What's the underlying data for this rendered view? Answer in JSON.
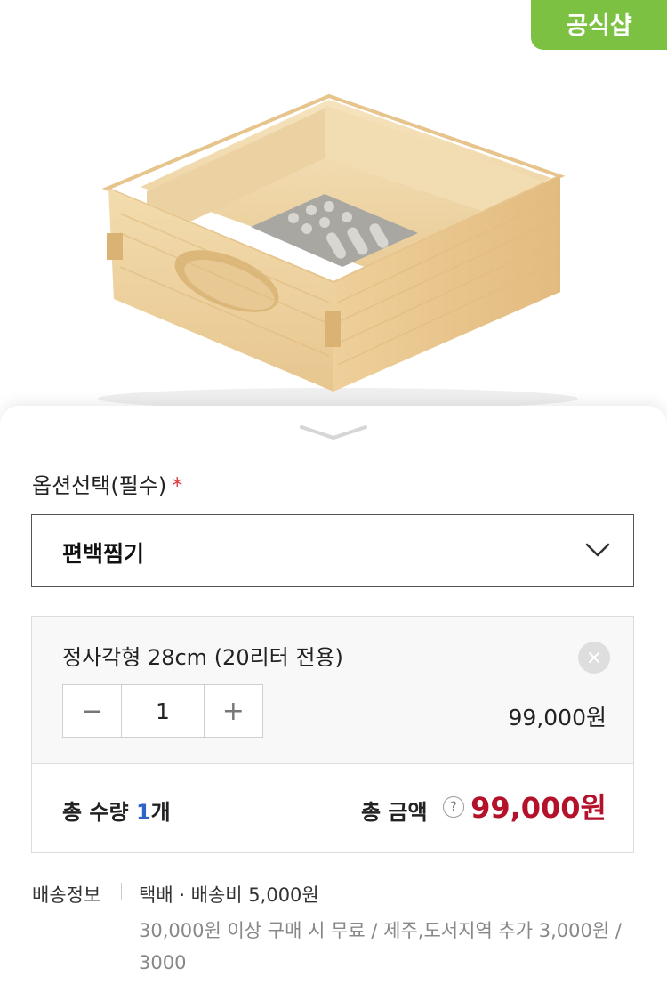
{
  "badge": {
    "label": "공식샵"
  },
  "options": {
    "label": "옵션선택(필수)",
    "required_mark": "*",
    "selected_value": "편백찜기"
  },
  "selected_item": {
    "name": "정사각형 28cm (20리터 전용)",
    "quantity": "1",
    "price": "99,000원",
    "decrease": "−",
    "increase": "+"
  },
  "totals": {
    "qty_prefix": "총 수량 ",
    "qty_value": "1",
    "qty_unit": "개",
    "amount_label": "총 금액",
    "help": "?",
    "amount_value": "99,000원"
  },
  "shipping": {
    "label": "배송정보",
    "line1": "택배 · 배송비 5,000원",
    "line2": "30,000원 이상 구매 시 무료 / 제주,도서지역 추가 3,000원 / 3000"
  },
  "colors": {
    "badge": "#7cc142",
    "total_amount": "#b3122a",
    "qty_accent": "#2f63c7",
    "required": "#e0383e"
  }
}
